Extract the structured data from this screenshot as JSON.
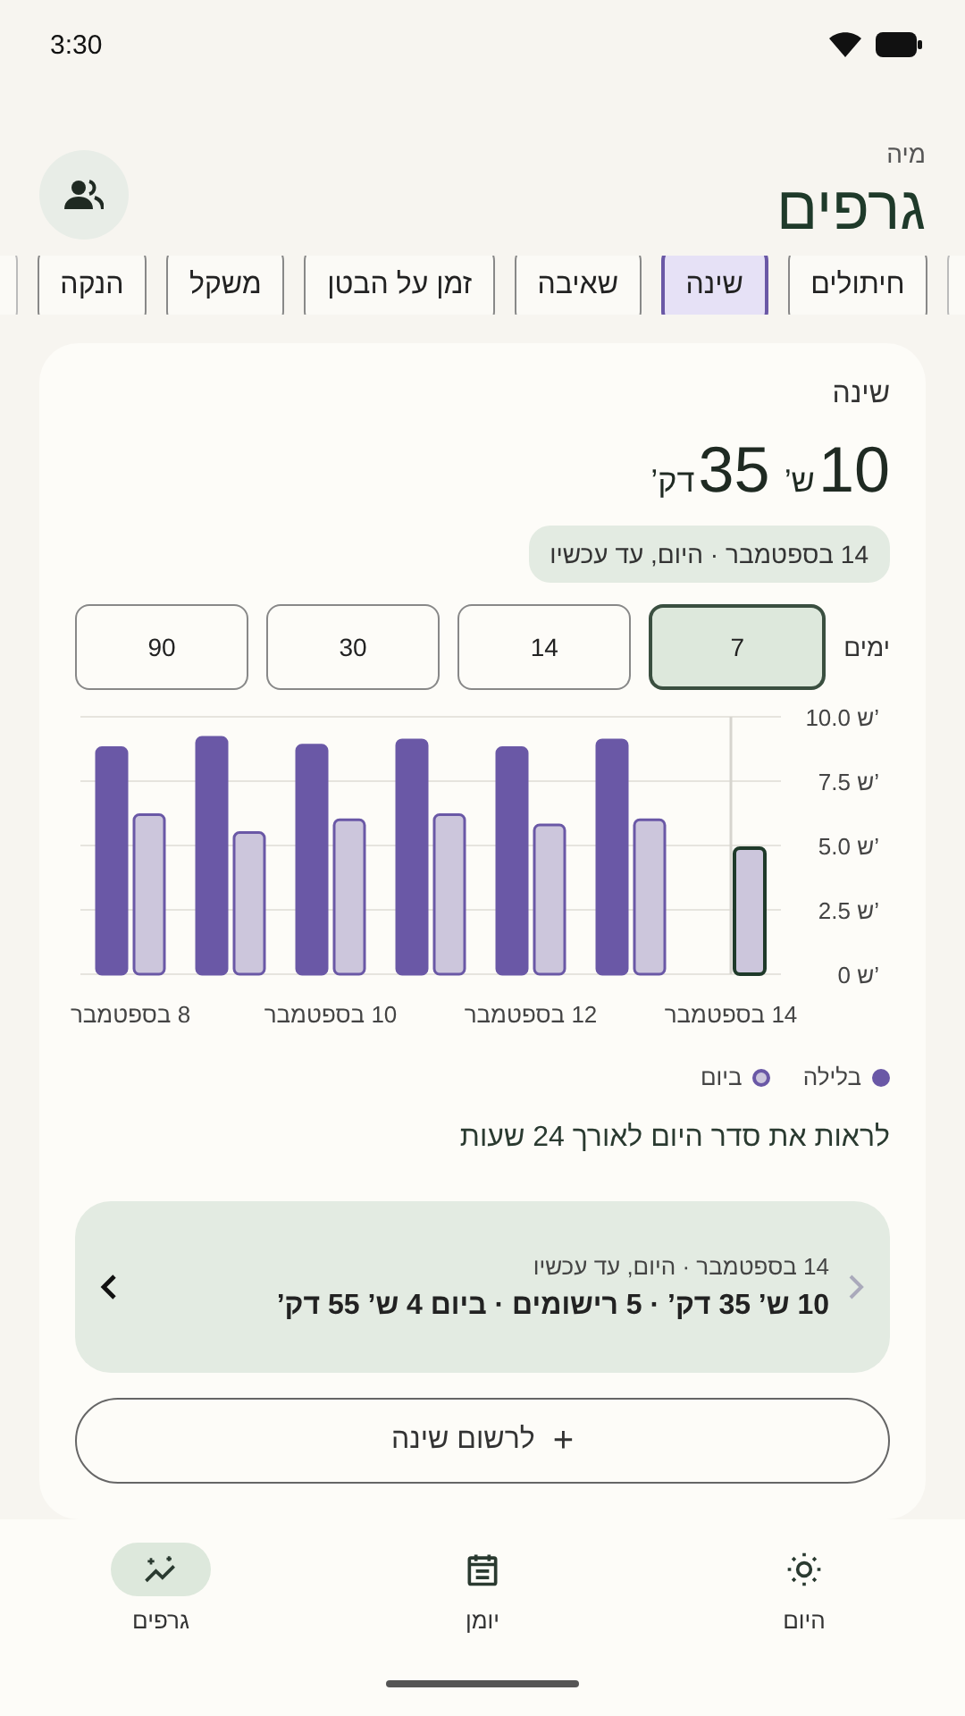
{
  "status_bar": {
    "time": "3:30"
  },
  "header": {
    "profile": "מיה",
    "title": "גרפים"
  },
  "tabs": [
    {
      "label": "חיתולים",
      "selected": false
    },
    {
      "label": "שינה",
      "selected": true
    },
    {
      "label": "שאיבה",
      "selected": false
    },
    {
      "label": "זמן על הבטן",
      "selected": false
    },
    {
      "label": "משקל",
      "selected": false
    },
    {
      "label": "הנקה",
      "selected": false
    }
  ],
  "card": {
    "label": "שינה",
    "total": [
      {
        "number": "10",
        "unit": "ש’"
      },
      {
        "number": "35",
        "unit": "דק’"
      }
    ],
    "date_pill": "14 בספטמבר · היום, עד עכשיו",
    "range_label": "ימים",
    "ranges": [
      {
        "label": "7",
        "selected": true
      },
      {
        "label": "14",
        "selected": false
      },
      {
        "label": "30",
        "selected": false
      },
      {
        "label": "90",
        "selected": false
      }
    ],
    "chart_data": {
      "type": "bar",
      "x": [
        8,
        9,
        10,
        11,
        12,
        13,
        14
      ],
      "series": [
        {
          "name": "בלילה",
          "color": "#6a58a6",
          "values": [
            8.8,
            9.2,
            8.9,
            9.1,
            8.8,
            9.1,
            null
          ]
        },
        {
          "name": "ביום",
          "color": "#ccc6dc",
          "values": [
            6.2,
            5.5,
            6.0,
            6.2,
            5.8,
            6.0,
            4.9
          ]
        }
      ],
      "ylim": [
        0,
        10
      ],
      "yticks": [
        {
          "value": 0,
          "label": "0 ש’"
        },
        {
          "value": 2.5,
          "label": "2.5 ש’"
        },
        {
          "value": 5,
          "label": "5.0 ש’"
        },
        {
          "value": 7.5,
          "label": "7.5 ש’"
        },
        {
          "value": 10,
          "label": "10.0 ש’"
        }
      ],
      "xticks": [
        {
          "value": 8,
          "label": "8 בספטמבר"
        },
        {
          "value": 10,
          "label": "10 בספטמבר"
        },
        {
          "value": 12,
          "label": "12 בספטמבר"
        },
        {
          "value": 14,
          "label": "14 בספטמבר"
        }
      ],
      "xlim": [
        7.5,
        14.5
      ],
      "grid": true,
      "ref_lines": [
        {
          "axis": "x",
          "value": 14
        }
      ]
    },
    "days": [
      {
        "selected": false
      },
      {
        "selected": false
      },
      {
        "selected": false
      },
      {
        "selected": false
      },
      {
        "selected": false
      },
      {
        "selected": false
      },
      {
        "selected": true
      }
    ],
    "link": "לראות את סדר היום לאורך 24 שעות",
    "summary": {
      "date": "14 בספטמבר · היום, עד עכשיו",
      "text": "10 ש’ 35 דק’ · 5 רישומים · ביום 4 ש’ 55 דק’",
      "prev_disabled": true,
      "next_disabled": false
    },
    "add_button": {
      "icon": "+",
      "label": "לרשום שינה"
    }
  },
  "nav": [
    {
      "label": "היום",
      "kind": "today",
      "selected": false
    },
    {
      "label": "יומן",
      "kind": "journal",
      "selected": false
    },
    {
      "label": "גרפים",
      "kind": "charts",
      "selected": true
    }
  ]
}
